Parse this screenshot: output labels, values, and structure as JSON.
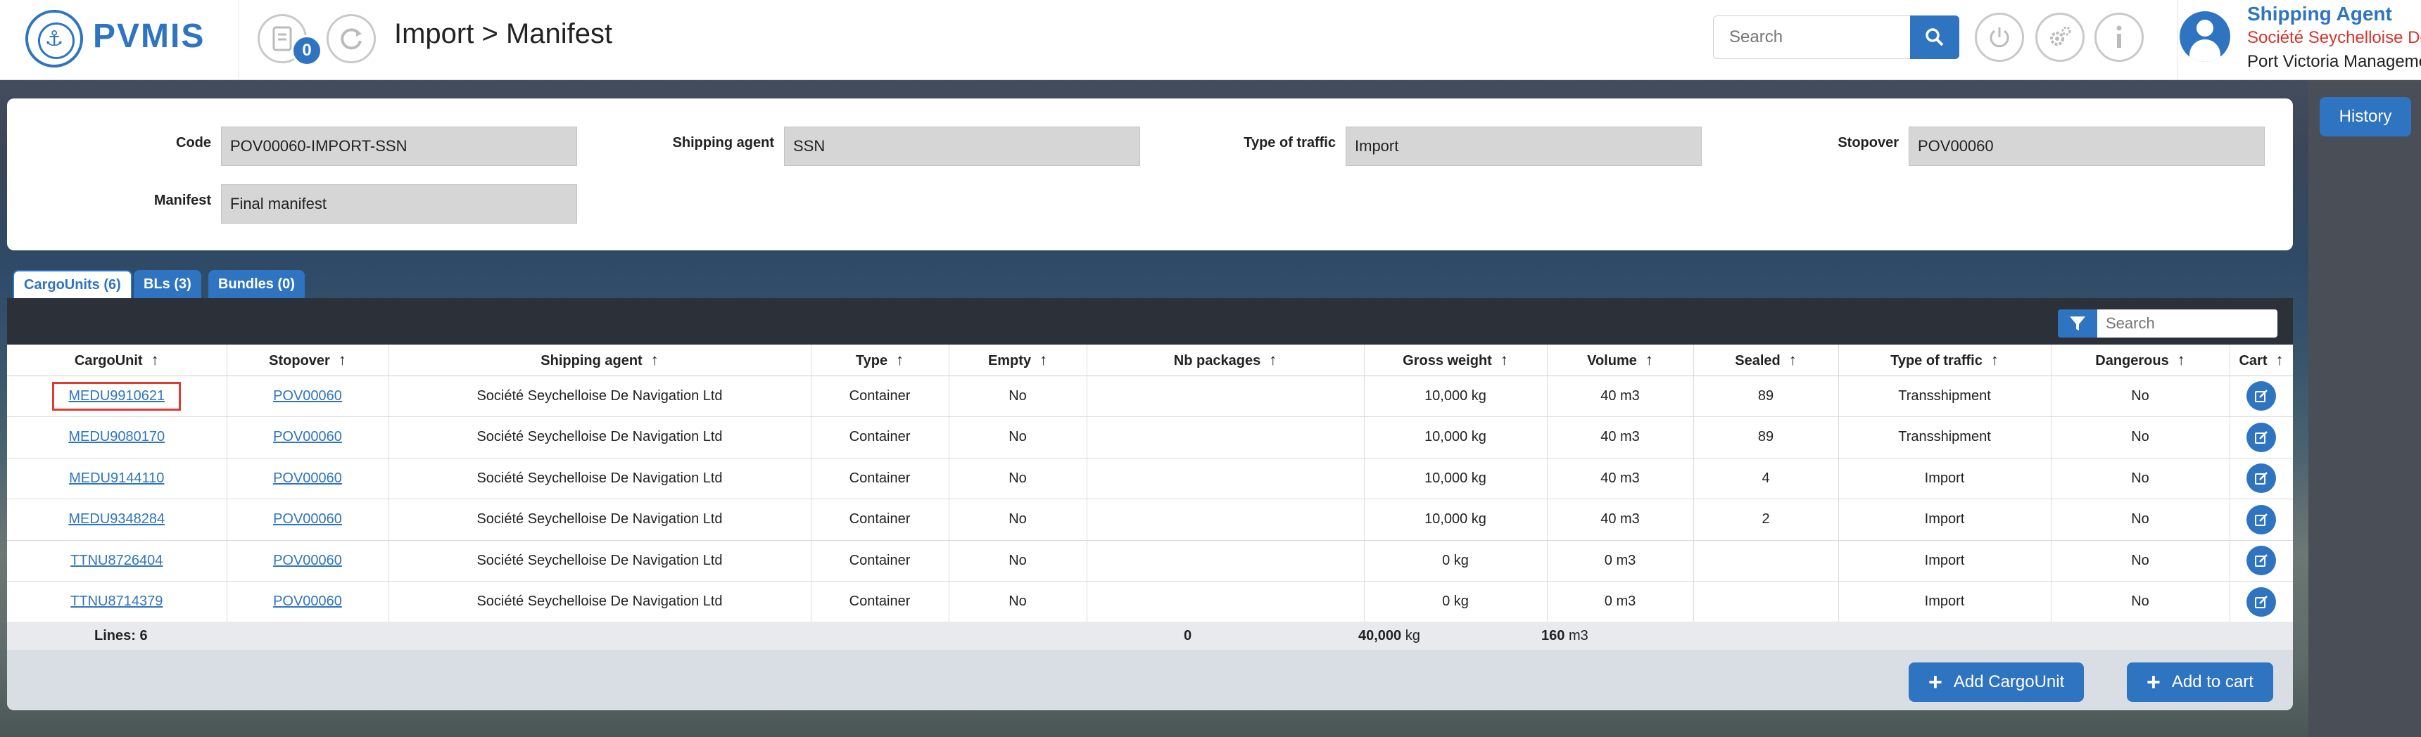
{
  "app": {
    "logo_text": "PVMIS",
    "title": "Import > Manifest"
  },
  "topbar": {
    "notification_count": "0",
    "search_placeholder": "Search",
    "user": {
      "role": "Shipping Agent",
      "company": "Société Seychelloise De",
      "organization": "Port Victoria Management"
    }
  },
  "sidebar": {
    "history_label": "History"
  },
  "form": {
    "code": {
      "label": "Code",
      "value": "POV00060-IMPORT-SSN"
    },
    "shipping_agent": {
      "label": "Shipping agent",
      "value": "SSN"
    },
    "type_of_traffic": {
      "label": "Type of traffic",
      "value": "Import"
    },
    "stopover": {
      "label": "Stopover",
      "value": "POV00060"
    },
    "manifest": {
      "label": "Manifest",
      "value": "Final manifest"
    }
  },
  "tabs": [
    {
      "label": "CargoUnits (6)",
      "active": true
    },
    {
      "label": "BLs (3)",
      "active": false
    },
    {
      "label": "Bundles (0)",
      "active": false
    }
  ],
  "table": {
    "filter_placeholder": "Search",
    "columns": [
      "CargoUnit",
      "Stopover",
      "Shipping agent",
      "Type",
      "Empty",
      "Nb packages",
      "Gross weight",
      "Volume",
      "Sealed",
      "Type of traffic",
      "Dangerous",
      "Cart"
    ],
    "sort_glyph": "↑",
    "rows": [
      {
        "cargo_unit": "MEDU9910621",
        "stopover": "POV00060",
        "shipping_agent": "Société Seychelloise De Navigation Ltd",
        "type": "Container",
        "empty": "No",
        "nb_packages": "",
        "gross_weight": "10,000 kg",
        "volume": "40 m3",
        "sealed": "89",
        "type_of_traffic": "Transshipment",
        "dangerous": "No"
      },
      {
        "cargo_unit": "MEDU9080170",
        "stopover": "POV00060",
        "shipping_agent": "Société Seychelloise De Navigation Ltd",
        "type": "Container",
        "empty": "No",
        "nb_packages": "",
        "gross_weight": "10,000 kg",
        "volume": "40 m3",
        "sealed": "89",
        "type_of_traffic": "Transshipment",
        "dangerous": "No"
      },
      {
        "cargo_unit": "MEDU9144110",
        "stopover": "POV00060",
        "shipping_agent": "Société Seychelloise De Navigation Ltd",
        "type": "Container",
        "empty": "No",
        "nb_packages": "",
        "gross_weight": "10,000 kg",
        "volume": "40 m3",
        "sealed": "4",
        "type_of_traffic": "Import",
        "dangerous": "No"
      },
      {
        "cargo_unit": "MEDU9348284",
        "stopover": "POV00060",
        "shipping_agent": "Société Seychelloise De Navigation Ltd",
        "type": "Container",
        "empty": "No",
        "nb_packages": "",
        "gross_weight": "10,000 kg",
        "volume": "40 m3",
        "sealed": "2",
        "type_of_traffic": "Import",
        "dangerous": "No"
      },
      {
        "cargo_unit": "TTNU8726404",
        "stopover": "POV00060",
        "shipping_agent": "Société Seychelloise De Navigation Ltd",
        "type": "Container",
        "empty": "No",
        "nb_packages": "",
        "gross_weight": "0 kg",
        "volume": "0 m3",
        "sealed": "",
        "type_of_traffic": "Import",
        "dangerous": "No"
      },
      {
        "cargo_unit": "TTNU8714379",
        "stopover": "POV00060",
        "shipping_agent": "Société Seychelloise De Navigation Ltd",
        "type": "Container",
        "empty": "No",
        "nb_packages": "",
        "gross_weight": "0 kg",
        "volume": "0 m3",
        "sealed": "",
        "type_of_traffic": "Import",
        "dangerous": "No"
      }
    ],
    "footer": {
      "lines": "Lines: 6",
      "nb_packages_total": "0",
      "gross_weight_total": "40,000",
      "gross_weight_unit": "kg",
      "volume_total": "160",
      "volume_unit": "m3"
    }
  },
  "actions": {
    "add_cargo_unit": "Add CargoUnit",
    "add_to_cart": "Add to cart",
    "plus_glyph": "+"
  },
  "colors": {
    "primary": "#2f74c0",
    "highlight": "#e23a2e",
    "company_text": "#d9322c"
  }
}
